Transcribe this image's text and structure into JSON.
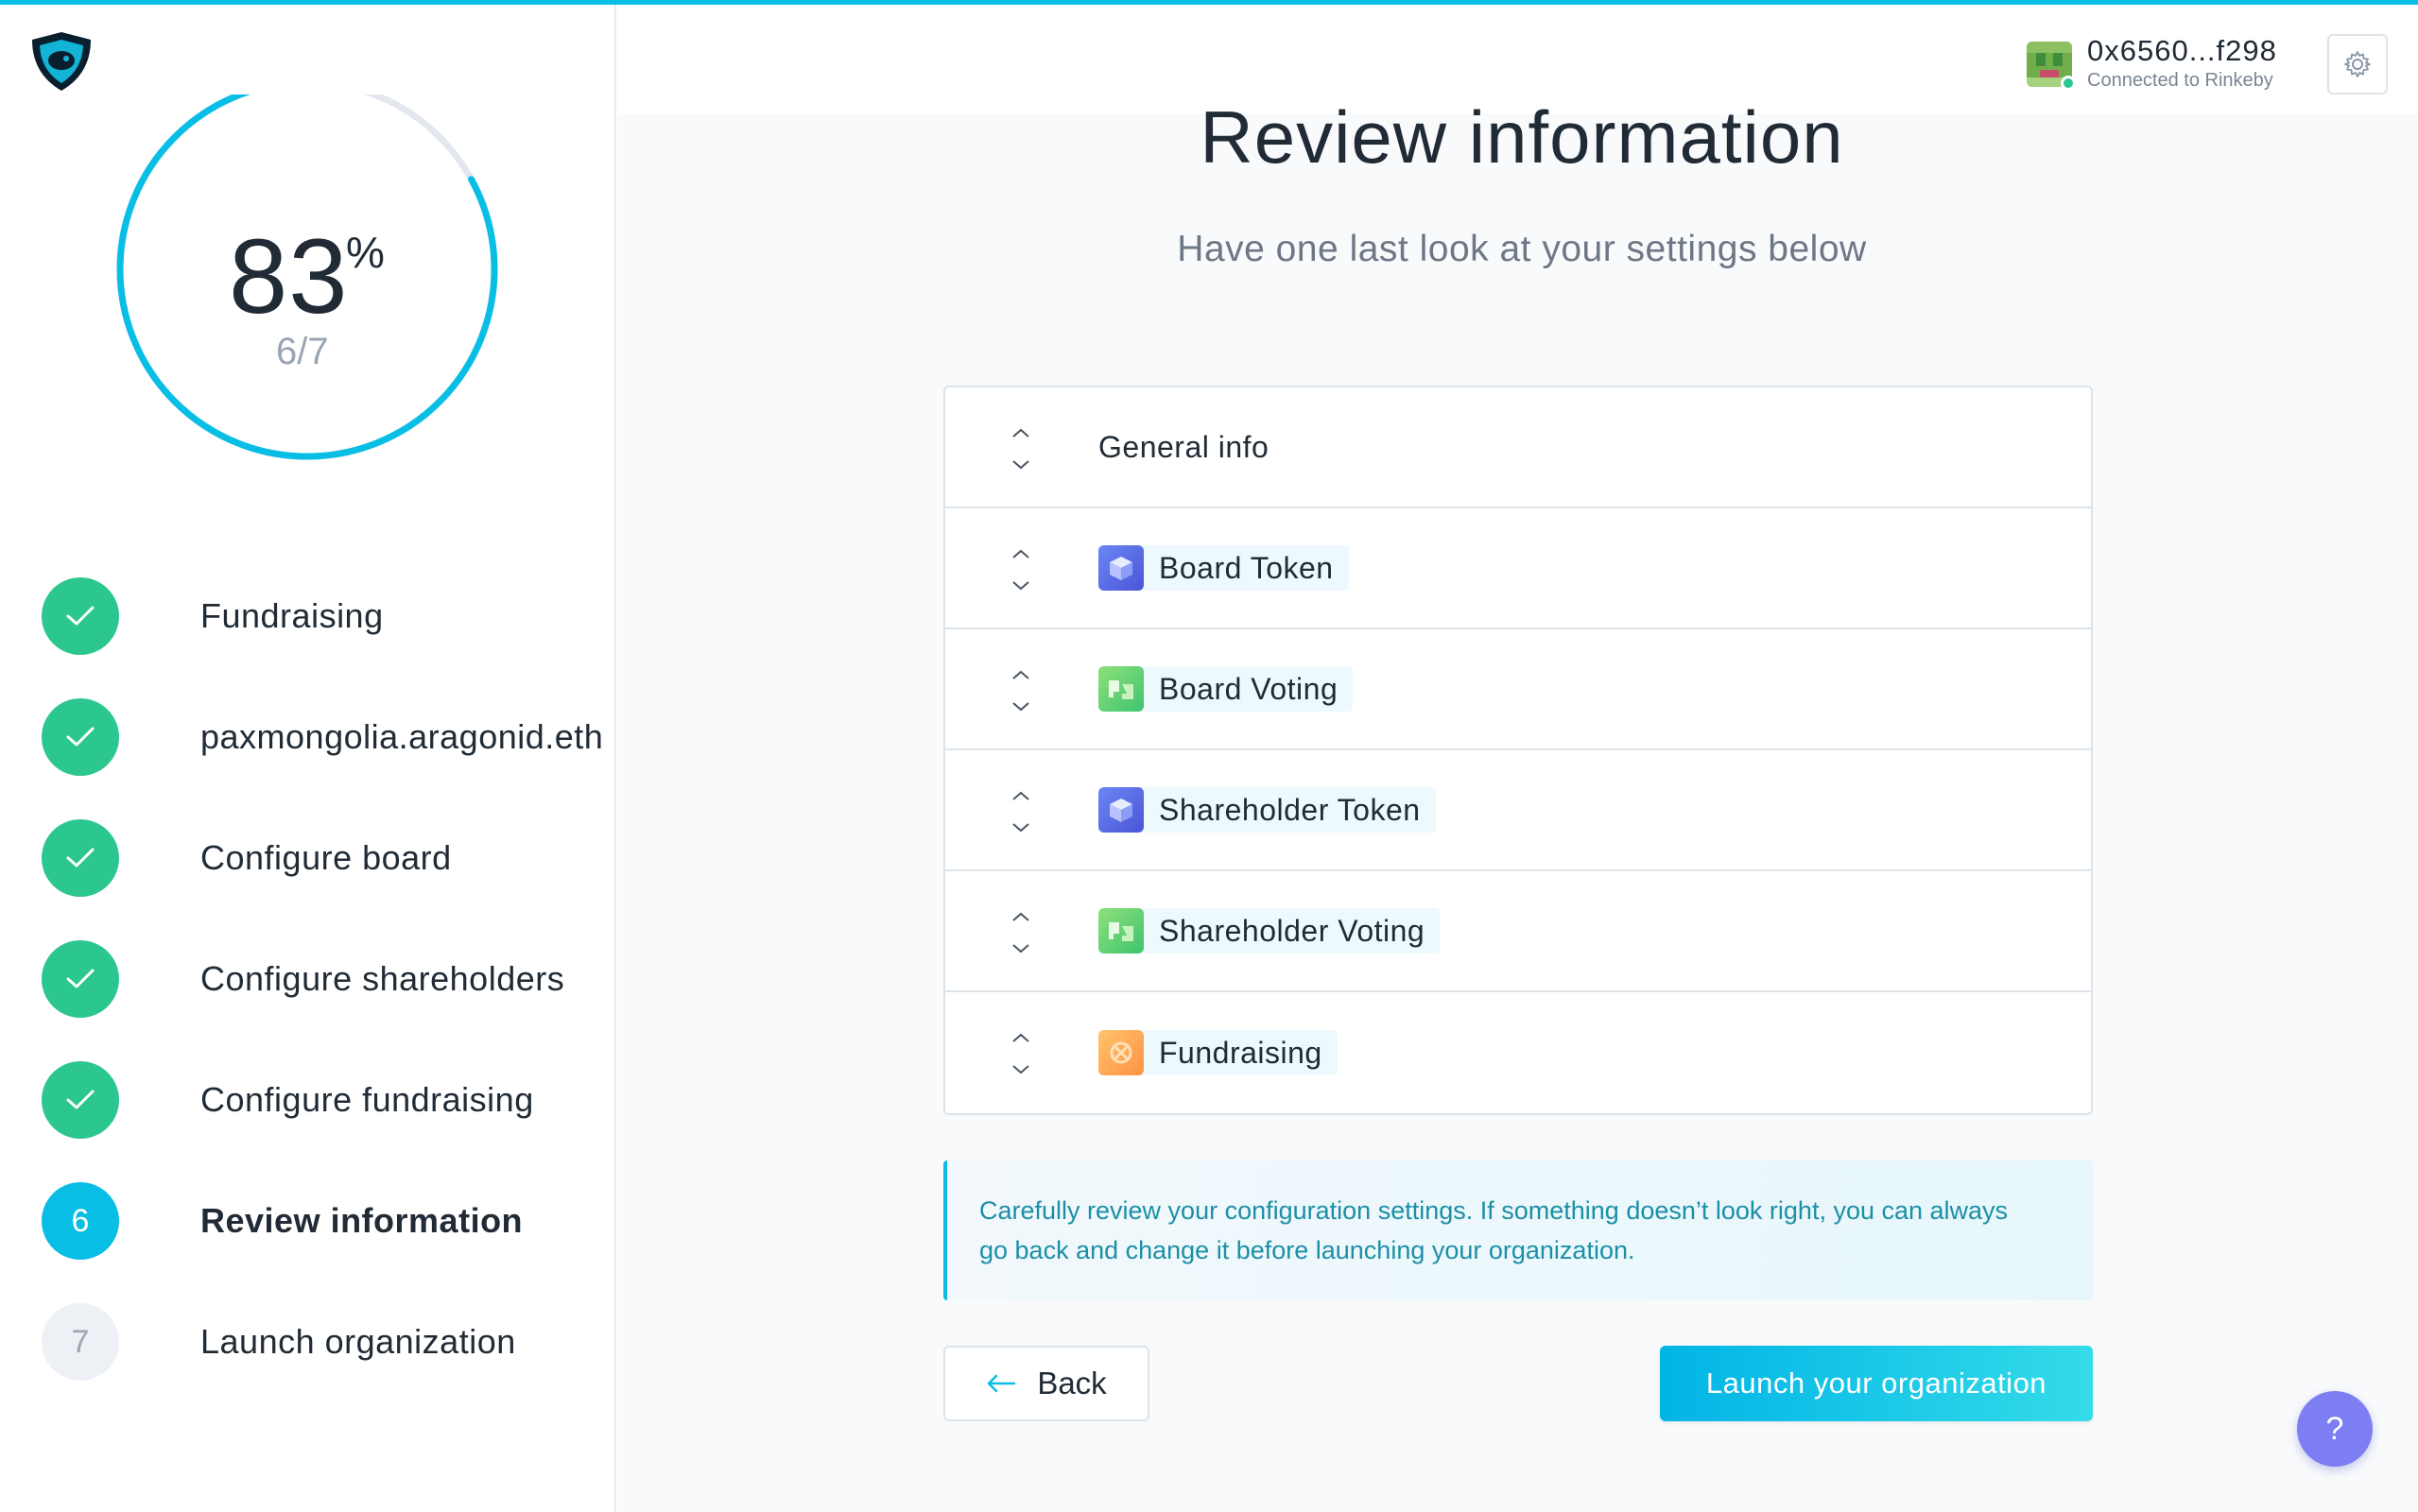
{
  "progress": {
    "percent": "83",
    "percent_sign": "%",
    "steps_text": "6/7",
    "fraction": 0.83
  },
  "steps": [
    {
      "label": "Fundraising",
      "state": "done"
    },
    {
      "label": "paxmongolia.aragonid.eth",
      "state": "done"
    },
    {
      "label": "Configure board",
      "state": "done"
    },
    {
      "label": "Configure shareholders",
      "state": "done"
    },
    {
      "label": "Configure fundraising",
      "state": "done"
    },
    {
      "label": "Review information",
      "state": "active",
      "number": "6"
    },
    {
      "label": "Launch organization",
      "state": "todo",
      "number": "7"
    }
  ],
  "account": {
    "address": "0x6560...f298",
    "network": "Connected to Rinkeby",
    "status_color": "#2cc68f"
  },
  "page": {
    "title": "Review information",
    "subtitle": "Have one last look at your settings below"
  },
  "review_rows": [
    {
      "label": "General info",
      "icon": "none"
    },
    {
      "label": "Board Token",
      "icon": "token-icon"
    },
    {
      "label": "Board Voting",
      "icon": "voting-icon"
    },
    {
      "label": "Shareholder Token",
      "icon": "token-icon"
    },
    {
      "label": "Shareholder Voting",
      "icon": "voting-icon"
    },
    {
      "label": "Fundraising",
      "icon": "fundraising-icon"
    }
  ],
  "info": {
    "line1": "Carefully review your configuration settings. If something doesn’t look right, you can always",
    "line2": "go back and change it before launching your organization."
  },
  "buttons": {
    "back": "Back",
    "launch": "Launch your organization",
    "help": "?"
  },
  "colors": {
    "accent": "#08bee5",
    "success": "#2cc68f",
    "help": "#7c7ef2"
  }
}
